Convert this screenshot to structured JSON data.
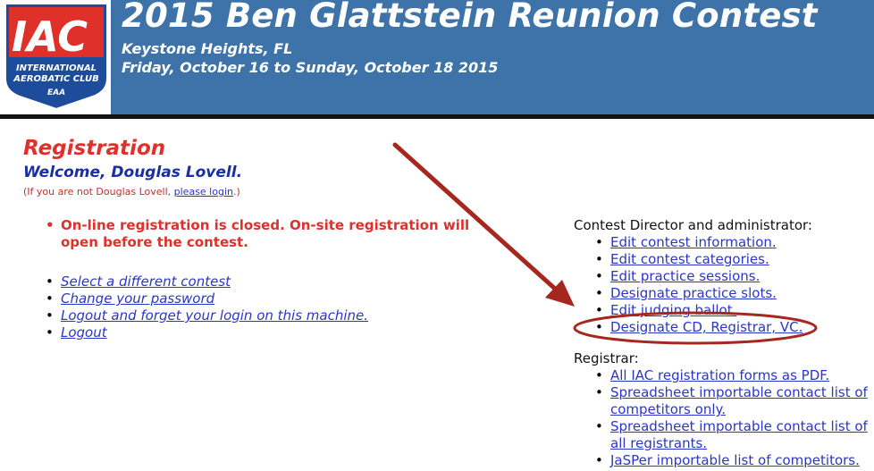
{
  "header": {
    "logo": {
      "letters": "IAC",
      "line1": "INTERNATIONAL",
      "line2": "AEROBATIC CLUB",
      "eaa": "EAA"
    },
    "title": "2015 Ben Glattstein Reunion Contest",
    "location": "Keystone Heights, FL",
    "dates": "Friday, October 16 to Sunday, October 18 2015"
  },
  "main": {
    "heading": "Registration",
    "welcome": "Welcome, Douglas Lovell.",
    "notice_prefix": "(If you are not Douglas Lovell, ",
    "notice_link": "please login",
    "notice_suffix": ".)",
    "closed_message": "On-line registration is closed. On-site registration will open before the contest.",
    "user_links": [
      "Select a different contest",
      "Change your password",
      "Logout and forget your login on this machine.",
      "Logout"
    ]
  },
  "admin": {
    "cd_label": "Contest Director and administrator:",
    "cd_links": [
      "Edit contest information.",
      "Edit contest categories.",
      "Edit practice sessions.",
      "Designate practice slots.",
      "Edit judging ballot.",
      "Designate CD, Registrar, VC."
    ],
    "registrar_label": "Registrar:",
    "registrar_links": [
      "All IAC registration forms as PDF.",
      "Spreadsheet importable contact list of competitors only.",
      "Spreadsheet importable contact list of all registrants.",
      "JaSPer importable list of competitors."
    ]
  },
  "colors": {
    "banner": "#3d73a8",
    "heading_red": "#e0302a",
    "welcome_blue": "#1a2fa0",
    "link_blue": "#2a36c8",
    "annotation": "#a5271d"
  }
}
